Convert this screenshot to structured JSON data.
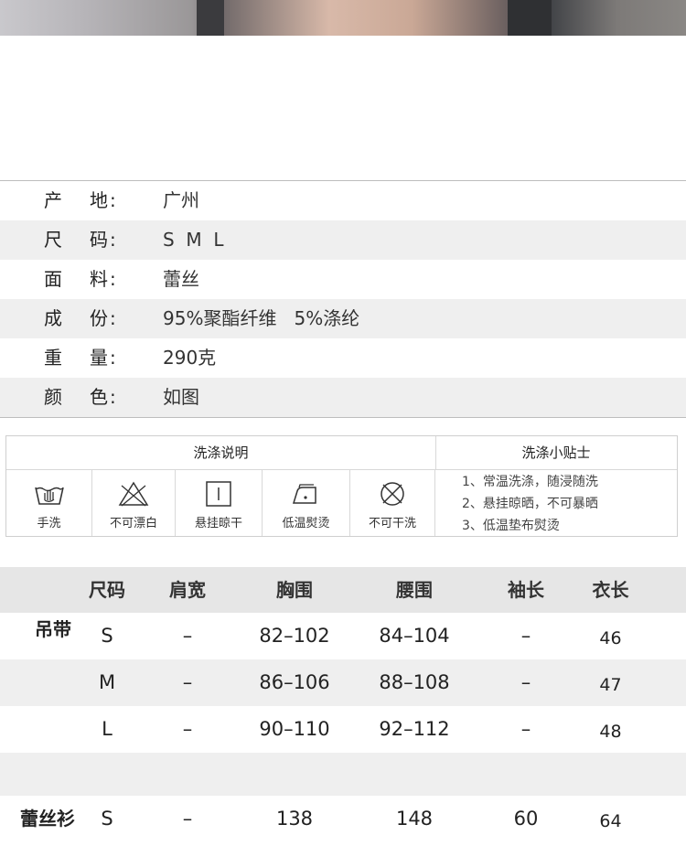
{
  "specs": [
    {
      "label": "产地",
      "value": "广州"
    },
    {
      "label": "尺码",
      "value": "S  M  L"
    },
    {
      "label": "面料",
      "value": "蕾丝"
    },
    {
      "label": "成份",
      "value": "95%聚酯纤维   5%涤纶"
    },
    {
      "label": "重量",
      "value": "290克"
    },
    {
      "label": "颜色",
      "value": "如图"
    }
  ],
  "colon": ":",
  "care": {
    "left_title": "洗涤说明",
    "right_title": "洗涤小贴士",
    "icons": [
      {
        "icon": "hand-wash-icon",
        "label": "手洗"
      },
      {
        "icon": "no-bleach-icon",
        "label": "不可漂白"
      },
      {
        "icon": "hang-dry-icon",
        "label": "悬挂晾干"
      },
      {
        "icon": "low-iron-icon",
        "label": "低温熨烫"
      },
      {
        "icon": "no-dry-clean-icon",
        "label": "不可干洗"
      }
    ],
    "tips": [
      "1、常温洗涤，随浸随洗",
      "2、悬挂晾晒，不可暴晒",
      "3、低温垫布熨烫"
    ]
  },
  "size_table": {
    "headers": [
      "尺码",
      "肩宽",
      "胸围",
      "腰围",
      "袖长",
      "衣长"
    ],
    "groups": [
      {
        "name": "吊带",
        "rows": [
          {
            "size": "S",
            "shoulder": "–",
            "bust": "82–102",
            "waist": "84–104",
            "sleeve": "–",
            "length": "46"
          },
          {
            "size": "M",
            "shoulder": "–",
            "bust": "86–106",
            "waist": "88–108",
            "sleeve": "–",
            "length": "47"
          },
          {
            "size": "L",
            "shoulder": "–",
            "bust": "90–110",
            "waist": "92–112",
            "sleeve": "–",
            "length": "48"
          }
        ]
      },
      {
        "name": "蕾丝衫",
        "rows": [
          {
            "size": "S",
            "shoulder": "–",
            "bust": "138",
            "waist": "148",
            "sleeve": "60",
            "length": "64"
          }
        ]
      }
    ]
  }
}
